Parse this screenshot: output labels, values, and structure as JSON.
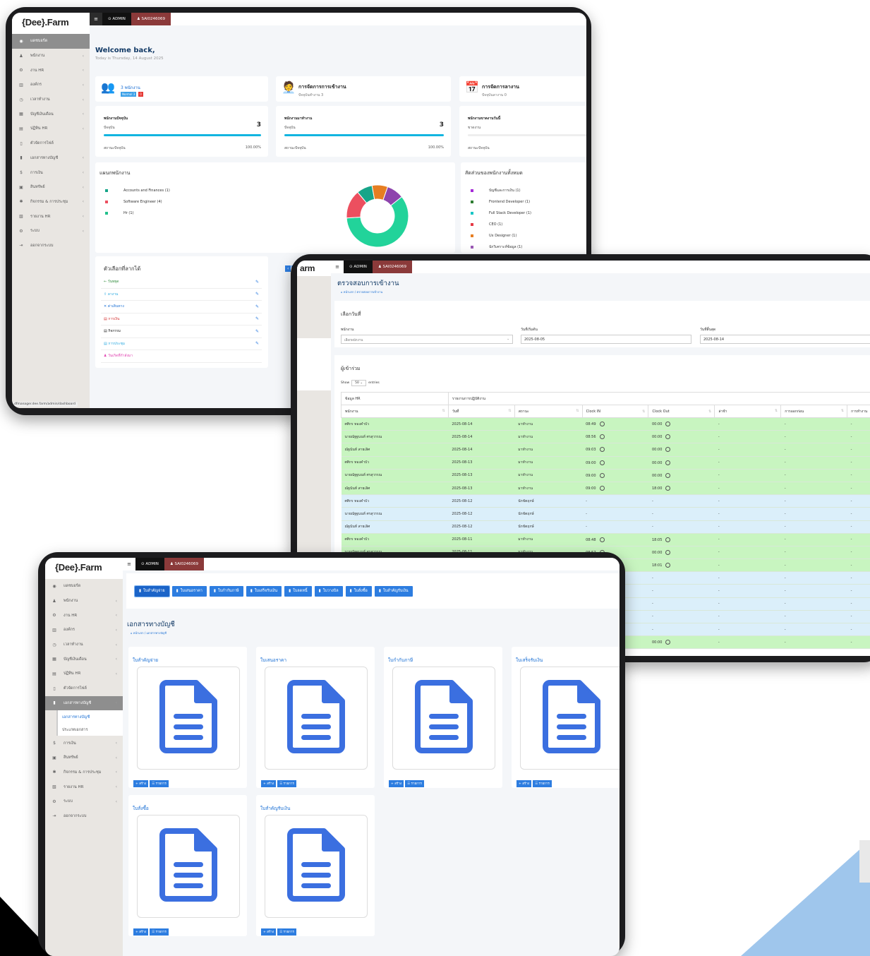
{
  "brand": {
    "name": "{Dee}.Farm",
    "name_partial": "arm"
  },
  "topbar": {
    "admin": "⊙ ADMIN",
    "user": "♟ SAI0246069"
  },
  "sidebar": {
    "items": [
      {
        "label": "แดชบอร์ด",
        "icon": "dashboard-icon",
        "glyph": "◉"
      },
      {
        "label": "พนักงาน",
        "icon": "user-icon",
        "glyph": "♟"
      },
      {
        "label": "งาน HR",
        "icon": "hr-icon",
        "glyph": "⚙"
      },
      {
        "label": "องค์กร",
        "icon": "building-icon",
        "glyph": "▥"
      },
      {
        "label": "เวลาทำงาน",
        "icon": "clock-icon",
        "glyph": "◷"
      },
      {
        "label": "บัญชีเงินเดือน",
        "icon": "calculator-icon",
        "glyph": "▦"
      },
      {
        "label": "ปฏิทิน HR",
        "icon": "calendar-icon",
        "glyph": "▤"
      },
      {
        "label": "ตัวจัดการไฟล์",
        "icon": "file-icon",
        "glyph": "▯"
      },
      {
        "label": "เอกสารทางบัญชี",
        "icon": "document-icon",
        "glyph": "▮"
      },
      {
        "label": "การเงิน",
        "icon": "money-icon",
        "glyph": "$"
      },
      {
        "label": "สินทรัพย์",
        "icon": "box-icon",
        "glyph": "▣"
      },
      {
        "label": "กิจกรรม & การประชุม",
        "icon": "event-icon",
        "glyph": "✱"
      },
      {
        "label": "รายงาน HR",
        "icon": "report-icon",
        "glyph": "▧"
      },
      {
        "label": "ระบบ",
        "icon": "gear-icon",
        "glyph": "⚙"
      },
      {
        "label": "ออกจากระบบ",
        "icon": "logout-icon",
        "glyph": "⇥"
      }
    ],
    "submenu": [
      "เอกสารทางบัญชี",
      "ประเภทเอกสาร"
    ]
  },
  "dashboard": {
    "welcome": "Welcome back,",
    "date": "Today is Thursday, 14 August 2025",
    "stat1": {
      "count": "3",
      "unit": "พนักงาน",
      "badge": "Normal 3",
      "badge2": "0"
    },
    "stat2": {
      "title": "การจัดการการเข้างาน",
      "sub": "ปัจจุบันทำงาน 3"
    },
    "stat3": {
      "title": "การจัดการลางาน",
      "sub": "ปัจจุบันลางาน 0"
    },
    "prog": [
      {
        "title": "พนักงานปัจจุบัน",
        "sub": "ปัจจุบัน",
        "value": "3",
        "status": "สถานะปัจจุบัน",
        "pct": "100.00%",
        "fill": 1.0
      },
      {
        "title": "พนักงานมาทำงาน",
        "sub": "ปัจจุบัน",
        "value": "3",
        "status": "สถานะปัจจุบัน",
        "pct": "100.00%",
        "fill": 1.0
      },
      {
        "title": "พนักงานขาดงานวันนี้",
        "sub": "ขาดงาน",
        "value": "",
        "status": "สถานะปัจจุบัน",
        "pct": "",
        "fill": 0
      }
    ],
    "dept": {
      "title": "แผนกพนักงาน",
      "items": [
        {
          "label": "Accounts and Finances (1)",
          "color": "#17a589"
        },
        {
          "label": "Software Engineer (4)",
          "color": "#ec4f5f"
        },
        {
          "label": "Hr (1)",
          "color": "#22c08c"
        }
      ]
    },
    "ratio": {
      "title": "สัดส่วนของพนักงานทั้งหมด",
      "items": [
        {
          "label": "บัญชีและการเงิน (1)",
          "color": "#a62bd8"
        },
        {
          "label": "Frontend Developer (1)",
          "color": "#2e7d32"
        },
        {
          "label": "Full Stack Developer (1)",
          "color": "#19c6c6"
        },
        {
          "label": "CEO (1)",
          "color": "#e53945"
        },
        {
          "label": "Ux Designer (1)",
          "color": "#e67e22"
        },
        {
          "label": "นักวิเคราะห์ข้อมูล (1)",
          "color": "#9b59b6"
        }
      ]
    },
    "donut": [
      {
        "value": 4,
        "color": "#22d39a"
      },
      {
        "value": 1,
        "color": "#ec4f5f"
      },
      {
        "value": 0.55,
        "color": "#17a589"
      },
      {
        "value": 0.55,
        "color": "#e67e22"
      },
      {
        "value": 0.6,
        "color": "#8e44ad"
      }
    ],
    "options": {
      "title": "ตัวเลือกที่ลากได้",
      "items": [
        {
          "label": "← วันหยุด",
          "color": "#2e8b3a"
        },
        {
          "label": "⇧ ลางาน",
          "color": "#2aa9e0"
        },
        {
          "label": "✕ ค่าเดินทาง",
          "color": "#1a6fd4"
        },
        {
          "label": "▤ การเงิน",
          "color": "#d32f2f"
        },
        {
          "label": "▤ กิจกรรม",
          "color": "#222"
        },
        {
          "label": "▤ การประชุม",
          "color": "#2aa9e0"
        },
        {
          "label": "♟ วันเกิดที่กำลังมา",
          "color": "#e040b0"
        }
      ]
    },
    "url": "dfmanager.dee.farm/admin/dashboard"
  },
  "attendance": {
    "title": "ตรวจสอบการเข้างาน",
    "breadcrumb": "⌂ หน้าแรก / ตรวจสอบการเข้างาน",
    "filter_title": "เลือกวันที่",
    "employee_label": "พนักงาน",
    "employee_placeholder": "เลือกพนักงาน",
    "start_label": "วันที่เริ่มต้น",
    "start_value": "2025-08-05",
    "end_label": "วันที่สิ้นสุด",
    "end_value": "2025-08-14",
    "participants": "ผู้เข้าร่วม",
    "show": "Show",
    "show_val": "50",
    "entries": "entries",
    "group1": "ข้อมูล HR",
    "group2": "รายงานการปฏิบัติงาน",
    "columns": [
      "พนักงาน",
      "วันที่",
      "สถานะ",
      "Clock IN",
      "Clock Out",
      "ล่าช้า",
      "การออกก่อน",
      "การทำงาน"
    ],
    "rows": [
      {
        "name": "ศศิกร ทองคำบัว",
        "date": "2025-08-14",
        "status": "มาทำงาน",
        "in": "08:49",
        "out": "00:00",
        "late": "-",
        "early": "-",
        "work": "-",
        "c": "g"
      },
      {
        "name": "นายณัฐฐนนท์ ศรสุวรรณ",
        "date": "2025-08-14",
        "status": "มาทำงาน",
        "in": "08:56",
        "out": "00:00",
        "late": "-",
        "early": "-",
        "work": "-",
        "c": "g"
      },
      {
        "name": "ณัฐนันท์ สายเลิศ",
        "date": "2025-08-14",
        "status": "มาทำงาน",
        "in": "09:03",
        "out": "00:00",
        "late": "-",
        "early": "-",
        "work": "-",
        "c": "g"
      },
      {
        "name": "ศศิกร ทองคำบัว",
        "date": "2025-08-13",
        "status": "มาทำงาน",
        "in": "09:00",
        "out": "00:00",
        "late": "-",
        "early": "-",
        "work": "-",
        "c": "g"
      },
      {
        "name": "นายณัฐฐนนท์ ศรสุวรรณ",
        "date": "2025-08-13",
        "status": "มาทำงาน",
        "in": "09:00",
        "out": "00:00",
        "late": "-",
        "early": "-",
        "work": "-",
        "c": "g"
      },
      {
        "name": "ณัฐนันท์ สายเลิศ",
        "date": "2025-08-13",
        "status": "มาทำงาน",
        "in": "09:00",
        "out": "18:00",
        "late": "-",
        "early": "-",
        "work": "-",
        "c": "g"
      },
      {
        "name": "ศศิกร ทองคำบัว",
        "date": "2025-08-12",
        "status": "นักขัตฤกษ์",
        "in": "-",
        "out": "-",
        "late": "-",
        "early": "-",
        "work": "-",
        "c": "b"
      },
      {
        "name": "นายณัฐฐนนท์ ศรสุวรรณ",
        "date": "2025-08-12",
        "status": "นักขัตฤกษ์",
        "in": "-",
        "out": "-",
        "late": "-",
        "early": "-",
        "work": "-",
        "c": "b"
      },
      {
        "name": "ณัฐนันท์ สายเลิศ",
        "date": "2025-08-12",
        "status": "นักขัตฤกษ์",
        "in": "-",
        "out": "-",
        "late": "-",
        "early": "-",
        "work": "-",
        "c": "b"
      },
      {
        "name": "ศศิกร ทองคำบัว",
        "date": "2025-08-11",
        "status": "มาทำงาน",
        "in": "08:48",
        "out": "18:05",
        "late": "-",
        "early": "-",
        "work": "-",
        "c": "g"
      },
      {
        "name": "นายณัฐฐนนท์ ศรสุวรรณ",
        "date": "2025-08-11",
        "status": "มาทำงาน",
        "in": "08:57",
        "out": "00:00",
        "late": "-",
        "early": "-",
        "work": "-",
        "c": "g"
      },
      {
        "name": "ณัฐนันท์ สายเลิศ",
        "date": "2025-08-11",
        "status": "มาทำงาน",
        "in": "09:01",
        "out": "18:01",
        "late": "-",
        "early": "-",
        "work": "-",
        "c": "g"
      },
      {
        "name": "",
        "date": "",
        "status": "",
        "in": "",
        "out": "-",
        "late": "-",
        "early": "-",
        "work": "-",
        "c": "b"
      },
      {
        "name": "",
        "date": "",
        "status": "",
        "in": "",
        "out": "-",
        "late": "-",
        "early": "-",
        "work": "-",
        "c": "b"
      },
      {
        "name": "",
        "date": "",
        "status": "",
        "in": "",
        "out": "-",
        "late": "-",
        "early": "-",
        "work": "-",
        "c": "b"
      },
      {
        "name": "",
        "date": "",
        "status": "",
        "in": "",
        "out": "-",
        "late": "-",
        "early": "-",
        "work": "-",
        "c": "b"
      },
      {
        "name": "",
        "date": "",
        "status": "",
        "in": "",
        "out": "-",
        "late": "-",
        "early": "-",
        "work": "-",
        "c": "b"
      },
      {
        "name": "",
        "date": "",
        "status": "",
        "in": "",
        "out": "00:00",
        "late": "-",
        "early": "-",
        "work": "-",
        "c": "g"
      }
    ]
  },
  "accounting": {
    "tabs": [
      "ใบสำคัญจ่าย",
      "ใบเสนอราคา",
      "ใบกำกับภาษี",
      "ใบเสร็จรับเงิน",
      "ใบลดหนี้",
      "ใบวางบิล",
      "ใบสั่งซื้อ",
      "ใบสำคัญรับเงิน"
    ],
    "title": "เอกสารทางบัญชี",
    "breadcrumb": "⌂ หน้าแรก / เอกสารทางบัญชี",
    "cards": [
      "ใบสำคัญจ่าย",
      "ใบเสนอราคา",
      "ใบกำกับภาษี",
      "ใบเสร็จรับเงิน",
      "ใบสั่งซื้อ",
      "ใบสำคัญรับเงิน"
    ],
    "create": "+ สร้าง",
    "list": "☰ รายการ"
  }
}
